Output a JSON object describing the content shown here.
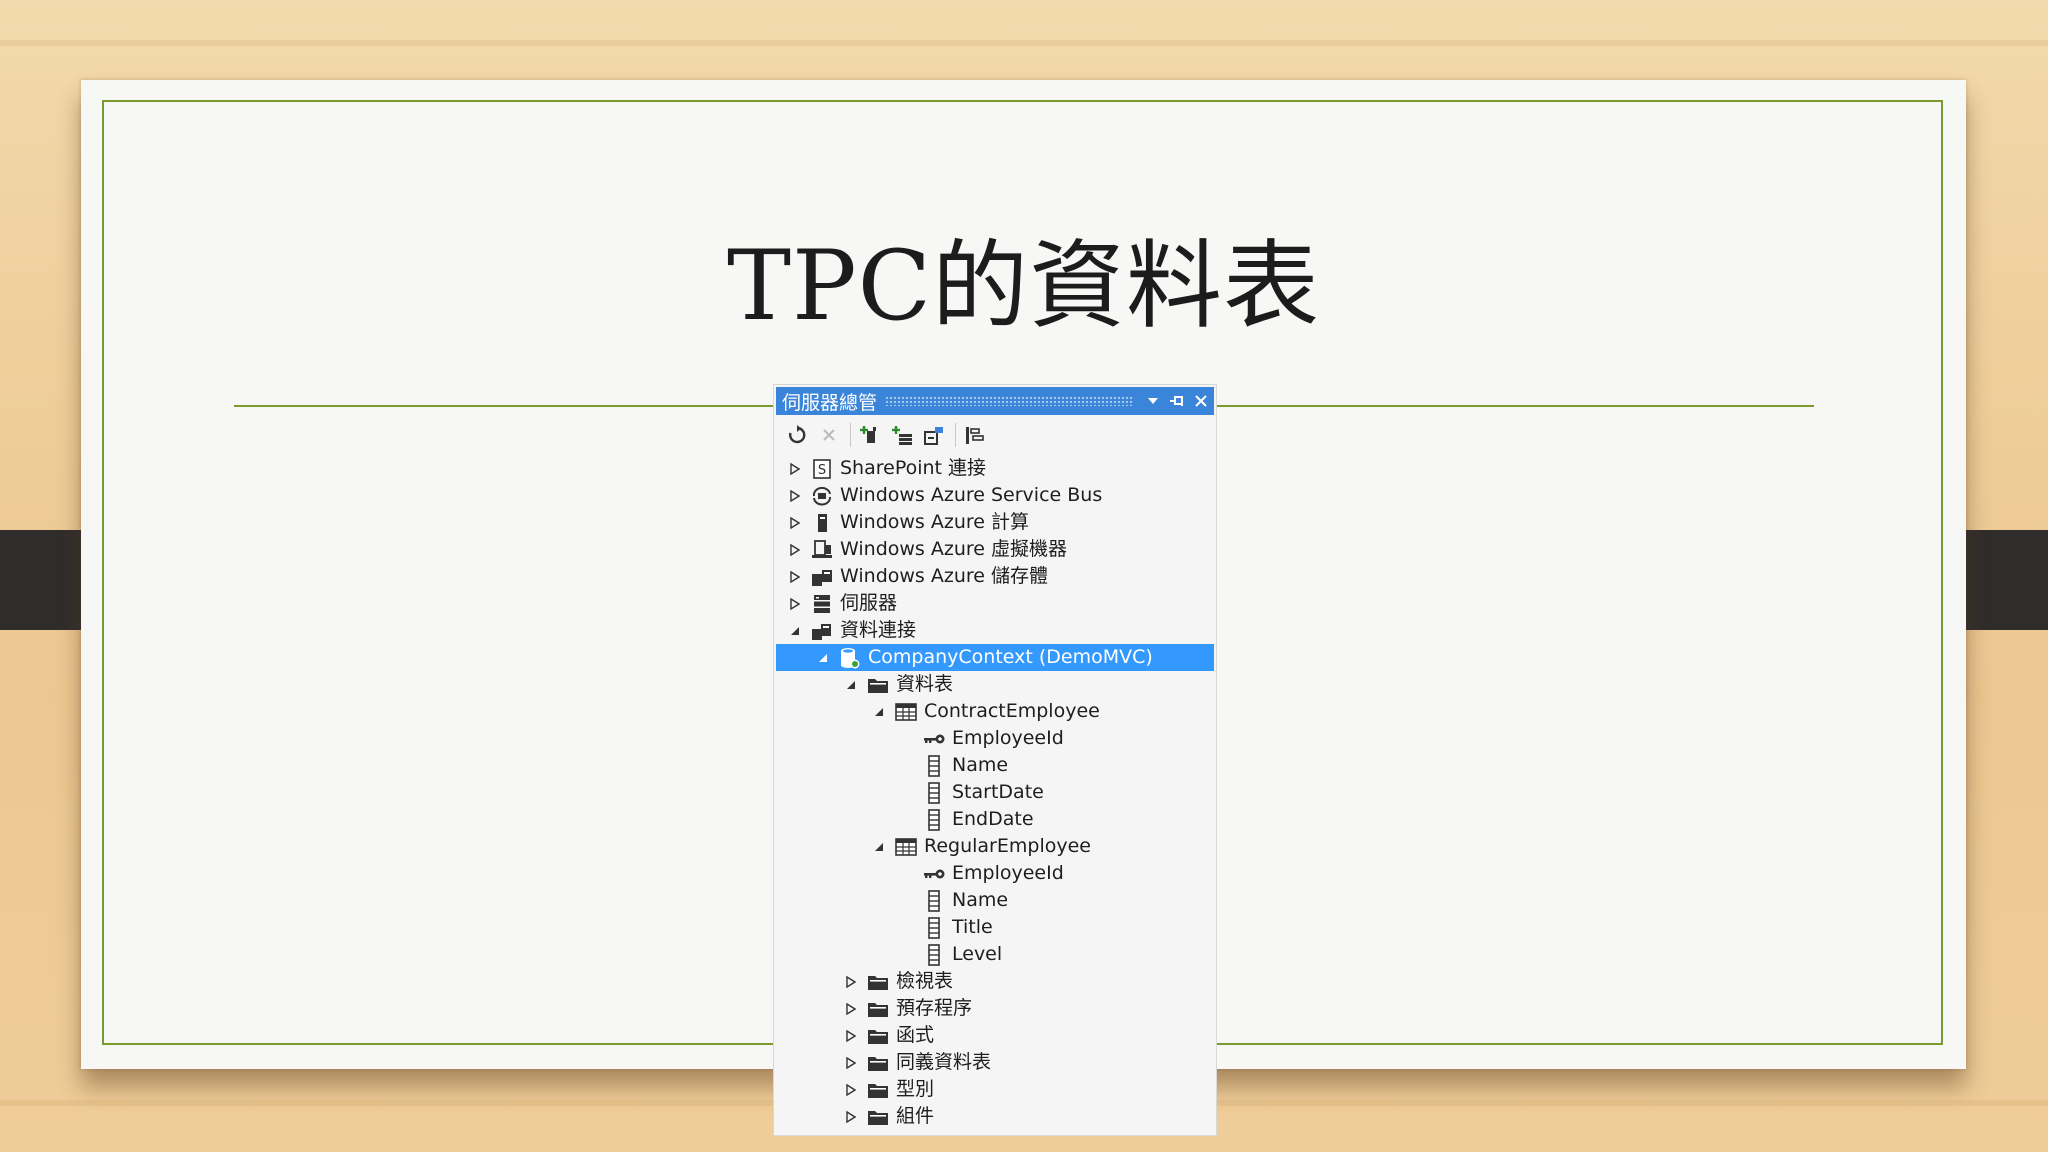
{
  "slide": {
    "title": "TPC的資料表"
  },
  "server_explorer": {
    "window_title": "伺服器總管",
    "title_buttons": {
      "dropdown": "▾",
      "pin": "⊣",
      "close": "✕"
    },
    "toolbar": [
      "refresh-icon",
      "stop-icon",
      "connect-to-database-icon",
      "connect-to-server-icon",
      "connect-to-sharepoint-icon",
      "properties-icon"
    ],
    "tree": [
      {
        "label": "SharePoint 連接",
        "level": 0,
        "expander": "collapsed",
        "icon": "sharepoint-icon"
      },
      {
        "label": "Windows Azure Service Bus",
        "level": 0,
        "expander": "collapsed",
        "icon": "service-bus-icon"
      },
      {
        "label": "Windows Azure 計算",
        "level": 0,
        "expander": "collapsed",
        "icon": "compute-icon"
      },
      {
        "label": "Windows Azure 虛擬機器",
        "level": 0,
        "expander": "collapsed",
        "icon": "virtual-machine-icon"
      },
      {
        "label": "Windows Azure 儲存體",
        "level": 0,
        "expander": "collapsed",
        "icon": "storage-icon"
      },
      {
        "label": "伺服器",
        "level": 0,
        "expander": "collapsed",
        "icon": "server-icon"
      },
      {
        "label": "資料連接",
        "level": 0,
        "expander": "expanded",
        "icon": "data-connection-icon"
      },
      {
        "label": "CompanyContext (DemoMVC)",
        "level": 1,
        "expander": "expanded",
        "icon": "database-icon",
        "selected": true
      },
      {
        "label": "資料表",
        "level": 2,
        "expander": "expanded",
        "icon": "folder-icon"
      },
      {
        "label": "ContractEmployee",
        "level": 3,
        "expander": "expanded",
        "icon": "table-icon"
      },
      {
        "label": "EmployeeId",
        "level": 4,
        "expander": "none",
        "icon": "key-icon"
      },
      {
        "label": "Name",
        "level": 4,
        "expander": "none",
        "icon": "column-icon"
      },
      {
        "label": "StartDate",
        "level": 4,
        "expander": "none",
        "icon": "column-icon"
      },
      {
        "label": "EndDate",
        "level": 4,
        "expander": "none",
        "icon": "column-icon"
      },
      {
        "label": "RegularEmployee",
        "level": 3,
        "expander": "expanded",
        "icon": "table-icon"
      },
      {
        "label": "EmployeeId",
        "level": 4,
        "expander": "none",
        "icon": "key-icon"
      },
      {
        "label": "Name",
        "level": 4,
        "expander": "none",
        "icon": "column-icon"
      },
      {
        "label": "Title",
        "level": 4,
        "expander": "none",
        "icon": "column-icon"
      },
      {
        "label": "Level",
        "level": 4,
        "expander": "none",
        "icon": "column-icon"
      },
      {
        "label": "檢視表",
        "level": 2,
        "expander": "collapsed",
        "icon": "folder-icon"
      },
      {
        "label": "預存程序",
        "level": 2,
        "expander": "collapsed",
        "icon": "folder-icon"
      },
      {
        "label": "函式",
        "level": 2,
        "expander": "collapsed",
        "icon": "folder-icon"
      },
      {
        "label": "同義資料表",
        "level": 2,
        "expander": "collapsed",
        "icon": "folder-icon"
      },
      {
        "label": "型別",
        "level": 2,
        "expander": "collapsed",
        "icon": "folder-icon"
      },
      {
        "label": "組件",
        "level": 2,
        "expander": "collapsed",
        "icon": "folder-icon"
      }
    ]
  },
  "colors": {
    "accent_green": "#7a9a2e",
    "titlebar_blue": "#3a84d9",
    "selection_blue": "#3399ff"
  }
}
